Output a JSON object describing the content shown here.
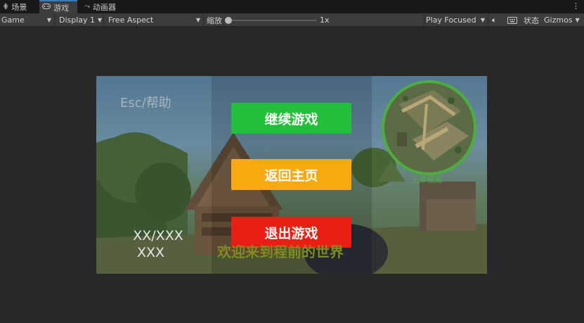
{
  "tabs": [
    {
      "label": "场景",
      "icon": "grid-icon"
    },
    {
      "label": "游戏",
      "icon": "gamepad-icon"
    },
    {
      "label": "动画器",
      "icon": "animator-icon"
    }
  ],
  "toolbar": {
    "game_dropdown": "Game",
    "display_dropdown": "Display 1",
    "aspect_dropdown": "Free Aspect",
    "scale_label": "缩放",
    "scale_value": "1x",
    "play_mode_dropdown": "Play Focused",
    "stats_label": "状态",
    "gizmos_label": "Gizmos"
  },
  "game_ui": {
    "esc_hint": "Esc/帮助",
    "continue_button": "继续游戏",
    "home_button": "返回主页",
    "exit_button": "退出游戏",
    "score_line1": "XX/XXX",
    "score_line2": "XXX",
    "welcome_text": "欢迎来到程前的世界",
    "minimap_label": "上帝视角"
  },
  "colors": {
    "continue": "#22c03a",
    "home": "#f7a90e",
    "exit": "#ea1e12",
    "minimap_border": "#4caf3c",
    "tab_accent": "#3a79bb"
  }
}
